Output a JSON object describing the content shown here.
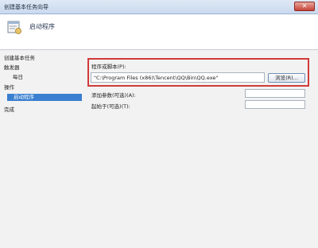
{
  "window": {
    "title": "创建基本任务向导",
    "close_label": "✕"
  },
  "header": {
    "title": "启动程序",
    "icon": "wizard-task-icon"
  },
  "sidebar": {
    "items": [
      {
        "label": "创建基本任务",
        "selected": false
      },
      {
        "label": "触发器",
        "selected": false
      },
      {
        "label": "每日",
        "selected": false
      },
      {
        "label": "操作",
        "selected": false
      },
      {
        "label": "启动程序",
        "selected": true
      },
      {
        "label": "完成",
        "selected": false
      }
    ]
  },
  "form": {
    "program_label": "程序或脚本(P):",
    "program_value": "\"C:\\Program Files (x86)\\Tencent\\QQ\\Bin\\QQ.exe\"",
    "browse_label": "浏览(R)...",
    "args_label": "添加参数(可选)(A):",
    "args_value": "",
    "startin_label": "起始于(可选)(T):",
    "startin_value": ""
  },
  "colors": {
    "highlight_border": "#d13a3a",
    "selected_bg": "#3a7fd0"
  }
}
